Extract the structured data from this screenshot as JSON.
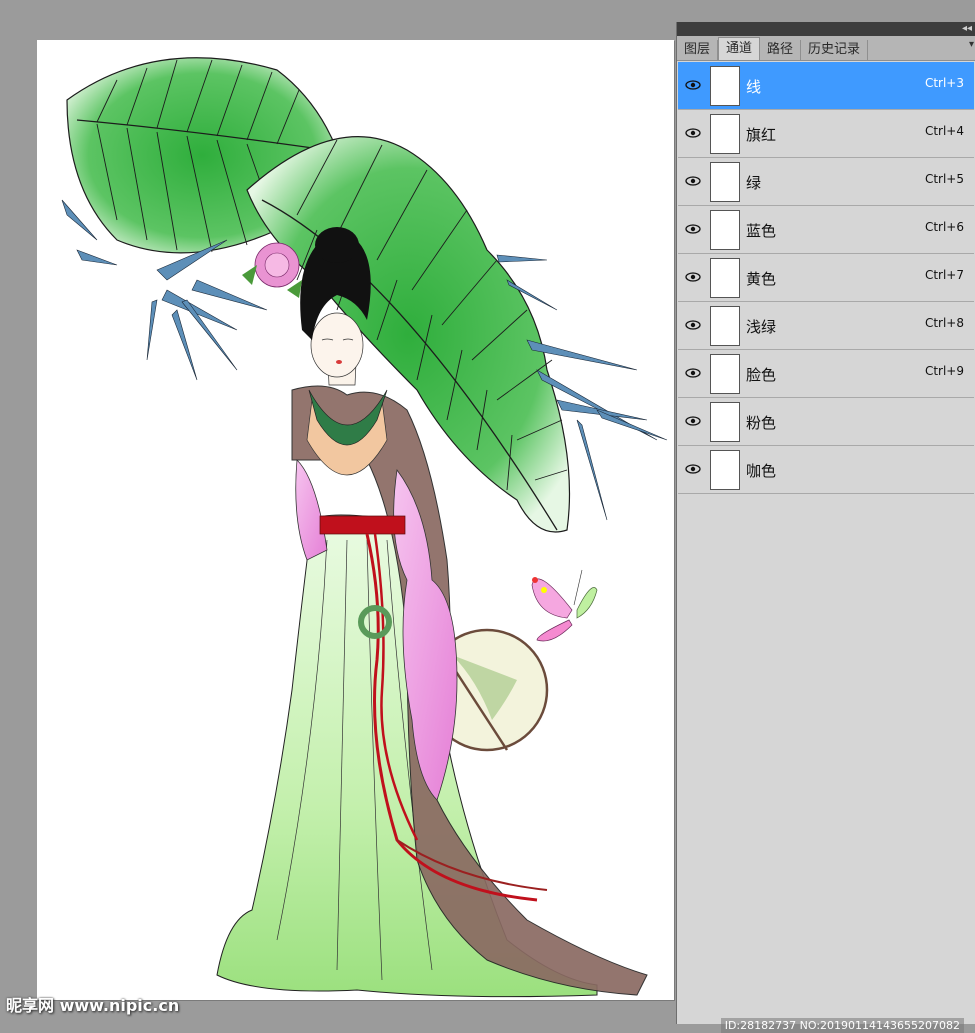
{
  "panel": {
    "tabs": [
      {
        "label": "图层"
      },
      {
        "label": "通道"
      },
      {
        "label": "路径"
      },
      {
        "label": "历史记录"
      }
    ],
    "active_tab": "通道",
    "channels": [
      {
        "name": "线",
        "shortcut": "Ctrl+3",
        "selected": true
      },
      {
        "name": "旗红",
        "shortcut": "Ctrl+4"
      },
      {
        "name": "绿",
        "shortcut": "Ctrl+5"
      },
      {
        "name": "蓝色",
        "shortcut": "Ctrl+6"
      },
      {
        "name": "黄色",
        "shortcut": "Ctrl+7"
      },
      {
        "name": "浅绿",
        "shortcut": "Ctrl+8"
      },
      {
        "name": "脸色",
        "shortcut": "Ctrl+9"
      },
      {
        "name": "粉色",
        "shortcut": ""
      },
      {
        "name": "咖色",
        "shortcut": ""
      }
    ]
  },
  "colors": {
    "selection": "#3f9aff",
    "panel_bg": "#d6d6d6",
    "workspace_bg": "#9b9b9b",
    "leaf_green": "#2e9a3a",
    "robe_green": "#c6f0b0",
    "sleeve_pink": "#f0a6e6",
    "sash_red": "#c0101c"
  },
  "watermark": {
    "left": "昵享网 www.nipic.cn",
    "right": "ID:28182737 NO:20190114143655207082"
  }
}
